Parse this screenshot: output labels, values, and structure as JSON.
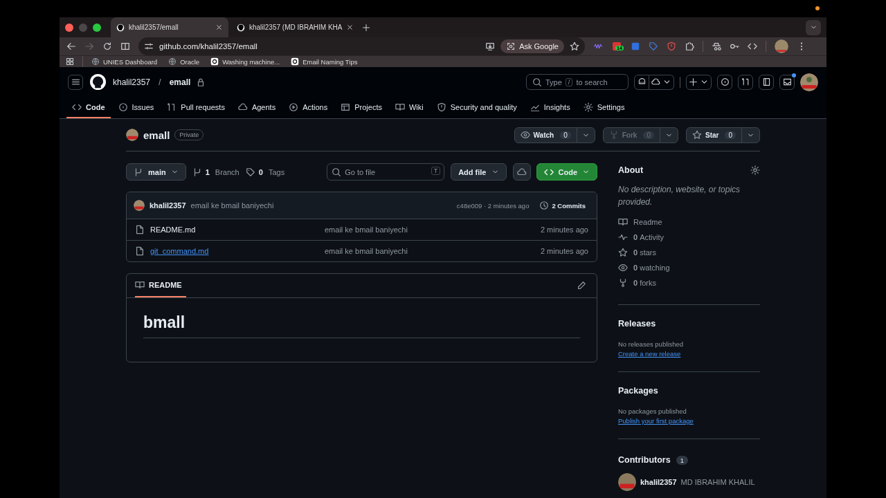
{
  "browser_tabs": [
    {
      "title": "khalil2357/emall",
      "selected": true
    },
    {
      "title": "khalil2357 (MD IBRAHIM KHA",
      "selected": false
    }
  ],
  "address_bar": {
    "url": "github.com/khalil2357/emall",
    "ask_google": "Ask Google",
    "extension_badge": "14"
  },
  "bookmarks": [
    "UNIES Dashboard",
    "Oracle",
    "Washing machine...",
    "Email Naming Tips"
  ],
  "header": {
    "owner": "khalil2357",
    "separator": "/",
    "repo": "emall",
    "search": {
      "before": "Type",
      "key": "/",
      "after": "to search"
    }
  },
  "repo_nav": [
    {
      "label": "Code",
      "selected": true
    },
    {
      "label": "Issues",
      "selected": false
    },
    {
      "label": "Pull requests",
      "selected": false
    },
    {
      "label": "Agents",
      "selected": false
    },
    {
      "label": "Actions",
      "selected": false
    },
    {
      "label": "Projects",
      "selected": false
    },
    {
      "label": "Wiki",
      "selected": false
    },
    {
      "label": "Security and quality",
      "selected": false
    },
    {
      "label": "Insights",
      "selected": false
    },
    {
      "label": "Settings",
      "selected": false
    }
  ],
  "repo": {
    "name": "emall",
    "visibility": "Private",
    "actions": [
      {
        "label": "Watch",
        "count": "0",
        "disabled": false
      },
      {
        "label": "Fork",
        "count": "0",
        "disabled": true
      },
      {
        "label": "Star",
        "count": "0",
        "disabled": false
      }
    ]
  },
  "toolbar": {
    "branch": "main",
    "branch_count": "1",
    "branch_label": "Branch",
    "tag_count": "0",
    "tag_label": "Tags",
    "go_to_file": {
      "placeholder": "Go to file",
      "key": "T"
    },
    "add_file": "Add file",
    "code": "Code"
  },
  "commit": {
    "author": "khalil2357",
    "message": "email ke bmail baniyechi",
    "hash": "c48e009 · 2 minutes ago",
    "commits": "2 Commits"
  },
  "files": [
    {
      "name": "README.md",
      "message": "email ke bmail baniyechi",
      "time": "2 minutes ago",
      "hovered": false
    },
    {
      "name": "git_command.md",
      "message": "email ke bmail baniyechi",
      "time": "2 minutes ago",
      "hovered": true
    }
  ],
  "readme": {
    "tab": "README",
    "heading": "bmall"
  },
  "about": {
    "title": "About",
    "description": "No description, website, or topics provided.",
    "items": [
      {
        "label": "Readme"
      },
      {
        "count": "0",
        "label": "Activity"
      },
      {
        "count": "0",
        "label": "stars"
      },
      {
        "count": "0",
        "label": "watching"
      },
      {
        "count": "0",
        "label": "forks"
      }
    ]
  },
  "releases": {
    "title": "Releases",
    "note": "No releases published",
    "link": "Create a new release"
  },
  "packages": {
    "title": "Packages",
    "note": "No packages published",
    "link": "Publish your first package"
  },
  "contributors": {
    "title": "Contributors",
    "count": "1",
    "people": [
      {
        "login": "khalil2357",
        "name": "MD IBRAHIM KHALIL"
      }
    ]
  }
}
